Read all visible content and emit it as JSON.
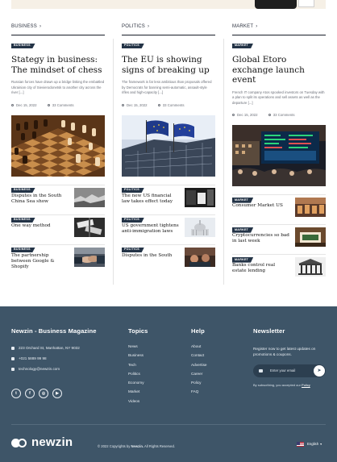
{
  "columns": [
    {
      "category": "BUSINESS",
      "badge": "BUSINESS",
      "headline": "Stategy in business: The mindset of chess",
      "excerpt": "Russian forces have drawn up a bridge linking the embattled Ukrainian city of Sievierodonetsk to another city across the river [...]",
      "date": "Dec 15, 2022",
      "comments": "33 Comments",
      "side": [
        {
          "badge": "BUSINESS",
          "title": "Disputes in the South China Sea show"
        },
        {
          "badge": "BUSINESS",
          "title": "One way method"
        },
        {
          "badge": "BUSINESS",
          "title": "The partnership between Google & Shopify"
        }
      ]
    },
    {
      "category": "POLITICS",
      "badge": "POLITICS",
      "headline": "The EU is showing signs of breaking up",
      "excerpt": "The framework is far less ambitious than proposals offered by Democrats for banning semi-automatic, assault-style rifles and high-capacity [...]",
      "date": "Dec 15, 2022",
      "comments": "33 Comments",
      "side": [
        {
          "badge": "POLITICS",
          "title": "The new US financial law takes effect today"
        },
        {
          "badge": "POLITICS",
          "title": "US government tightens anti-immigration laws"
        },
        {
          "badge": "POLITICS",
          "title": "Disputes in the South"
        }
      ]
    },
    {
      "category": "MARKET",
      "badge": "MARKET",
      "headline": "Global Etoro exchange launch event",
      "excerpt": "French IT company Atos spooked investors on Tuesday with a plan to split its operations and sell assets as well as the departure [...]",
      "date": "Dec 15, 2022",
      "comments": "33 Comments",
      "side": [
        {
          "badge": "MARKET",
          "title": "Consumer Market US"
        },
        {
          "badge": "MARKET",
          "title": "Cryptocurrencies so bad in last week"
        },
        {
          "badge": "MARKET",
          "title": "Banks control real estate lending"
        }
      ]
    }
  ],
  "footer": {
    "about_heading": "Newzin - Business Magazine",
    "address": "223 Orchard St, Manhattan, NY 9032",
    "phone": "+021 5889 99 98",
    "email": "technology@newzin.com",
    "socials": [
      "twitter",
      "facebook",
      "instagram",
      "youtube"
    ],
    "topics_heading": "Topics",
    "topics": [
      "News",
      "Business",
      "Tech",
      "Politics",
      "Economy",
      "Market",
      "Videos"
    ],
    "help_heading": "Help",
    "help": [
      "About",
      "Contact",
      "Advertise",
      "Career",
      "Policy",
      "FAQ"
    ],
    "newsletter_heading": "Newsletter",
    "newsletter_text": "Register now to get latest updates on promotions & coupons.",
    "email_placeholder": "Enter your email",
    "subscribe_note_pre": "By subscribing, you accepted our",
    "subscribe_note_link": "Policy",
    "brand": "newzin",
    "copyright_pre": "© 2022 Copyrights by",
    "copyright_brand": "Newzin.",
    "copyright_post": "All Rights Reserved.",
    "language": "English"
  },
  "colors": {
    "footer_bg": "#3e5568",
    "badge_bg": "#243447",
    "banner_bg": "#f6f0e6"
  }
}
